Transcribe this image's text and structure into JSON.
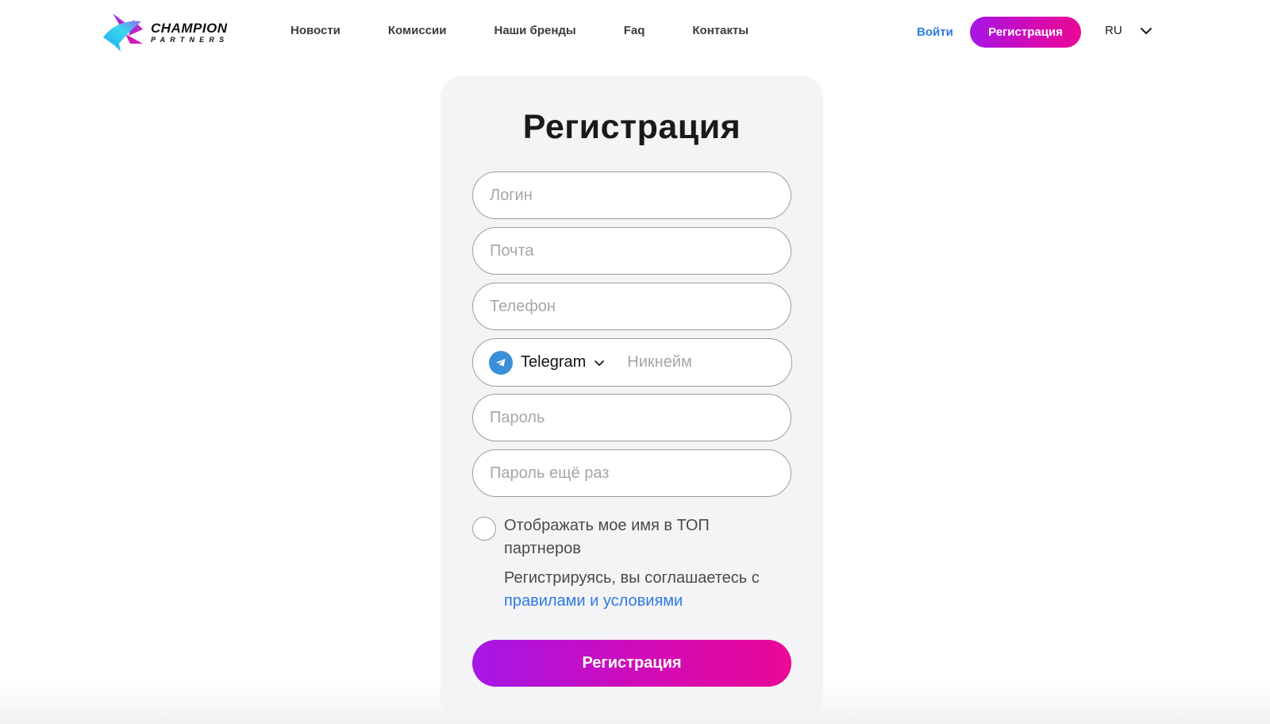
{
  "header": {
    "logo": {
      "title": "CHAMPION",
      "subtitle": "PARTNERS"
    },
    "nav": [
      {
        "label": "Новости"
      },
      {
        "label": "Комиссии"
      },
      {
        "label": "Наши бренды"
      },
      {
        "label": "Faq"
      },
      {
        "label": "Контакты"
      }
    ],
    "login_label": "Войти",
    "register_label": "Регистрация",
    "language": {
      "selected": "RU",
      "icon": "chevron-down-icon"
    }
  },
  "form": {
    "title": "Регистрация",
    "fields": {
      "login": {
        "placeholder": "Логин",
        "value": ""
      },
      "email": {
        "placeholder": "Почта",
        "value": ""
      },
      "phone": {
        "placeholder": "Телефон",
        "value": ""
      },
      "messenger": {
        "selected": "Telegram",
        "icon": "telegram-icon",
        "placeholder": "Никнейм",
        "value": ""
      },
      "password": {
        "placeholder": "Пароль",
        "value": ""
      },
      "password_repeat": {
        "placeholder": "Пароль ещё раз",
        "value": ""
      }
    },
    "show_in_top": {
      "label": "Отображать мое имя в ТОП партнеров",
      "checked": false
    },
    "terms": {
      "prefix": "Регистрируясь, вы соглашаетесь с ",
      "link": "правилами и условиями"
    },
    "submit_label": "Регистрация"
  },
  "colors": {
    "accent_gradient_start": "#a616e6",
    "accent_gradient_end": "#ea0896",
    "link": "#2c7be5",
    "telegram": "#3a8fd9",
    "card_bg": "#f4f4f6"
  }
}
